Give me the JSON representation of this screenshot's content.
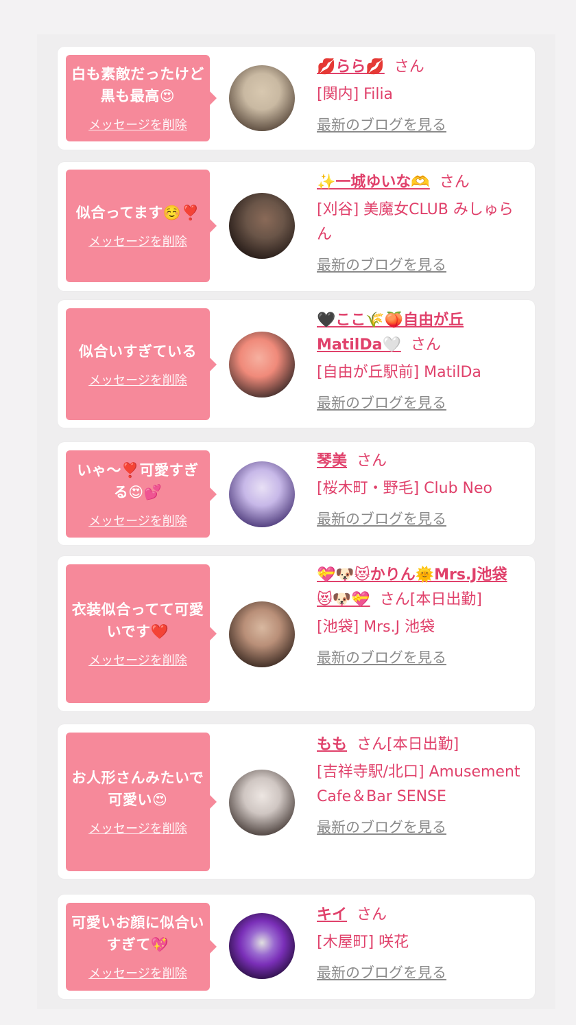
{
  "delete_label": "メッセージを削除",
  "blog_label": "最新のブログを見る",
  "honorific": "さん",
  "cards": [
    {
      "message": "白も素敵だったけど黒も最高😍",
      "name": "💋らら💋",
      "status": "",
      "shop": "[関内] Filia",
      "avatar_colors": [
        "#c9b9a2",
        "#5a4a3d"
      ]
    },
    {
      "message": "似合ってます☺️❣️",
      "name": "✨一城ゆいな🫶",
      "status": "",
      "shop": "[刈谷] 美魔女CLUB みしゅらん",
      "avatar_colors": [
        "#6a5548",
        "#221815"
      ]
    },
    {
      "message": "似合いすぎている",
      "name": "🖤ここ🌾🍑自由が丘MatilDa🤍",
      "status": "",
      "shop": "[自由が丘駅前] MatilDa",
      "avatar_colors": [
        "#f08a7a",
        "#3a2a28"
      ]
    },
    {
      "message": "いゃ〜❣️可愛すぎる😍💕",
      "name": "琴美",
      "status": "",
      "shop": "[桜木町・野毛] Club Neo",
      "avatar_colors": [
        "#c7b8e8",
        "#4d3a7a"
      ]
    },
    {
      "message": "衣装似合ってて可愛いです❤️",
      "name": "💝🐶😻かりん🌞Mrs.J池袋😻🐶💝",
      "status": "[本日出勤]",
      "shop": "[池袋] Mrs.J 池袋",
      "avatar_colors": [
        "#b98f78",
        "#3b2a22"
      ]
    },
    {
      "message": "お人形さんみたいで可愛い😍",
      "name": "もも",
      "status": "[本日出勤]",
      "shop": "[吉祥寺駅/北口] Amusement Cafe＆Bar SENSE",
      "avatar_colors": [
        "#cfc6c2",
        "#4a3f3b"
      ]
    },
    {
      "message": "可愛いお顔に似合いすぎて💖",
      "name": "キイ",
      "status": "",
      "shop": "[木屋町] 咲花",
      "avatar_colors": [
        "#7a2fb8",
        "#1a0a2a"
      ]
    }
  ]
}
